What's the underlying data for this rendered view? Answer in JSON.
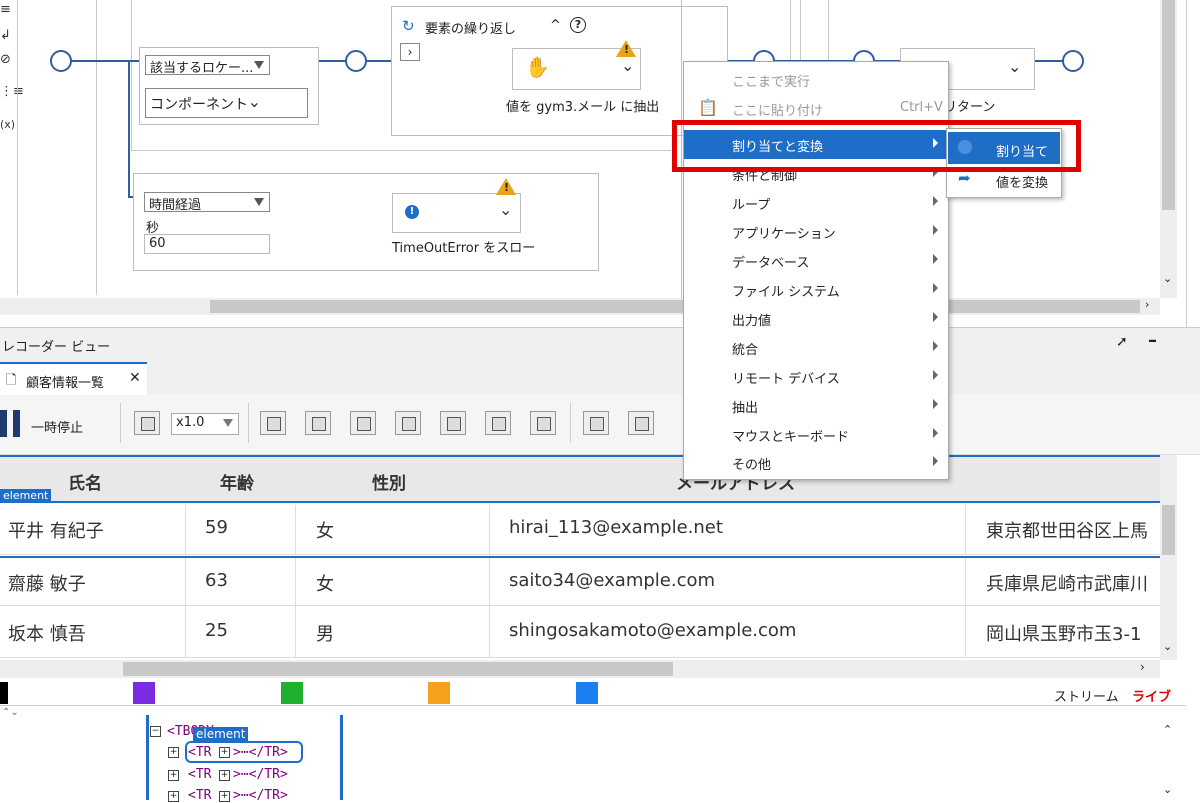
{
  "flow": {
    "locator_select": "該当するロケー...",
    "component_select": "コンポーネント",
    "loop_title": "要素の繰り返し",
    "loop_help": "?",
    "loop_collapse": "^",
    "extract_label": "値を gym3.メール に抽出",
    "timeout_select": "時間経過",
    "seconds_label": "秒",
    "seconds_value": "60",
    "throw_label": "TimeOutError をスロー",
    "return_label": "リターン"
  },
  "context_menu": {
    "items": [
      {
        "label": "ここまで実行",
        "disabled": true
      },
      {
        "label": "ここに貼り付け",
        "shortcut": "Ctrl+V",
        "disabled": true
      },
      {
        "label": "割り当てと変換",
        "highlighted": true
      },
      {
        "label": "条件と制御"
      },
      {
        "label": "ループ"
      },
      {
        "label": "アプリケーション"
      },
      {
        "label": "データベース"
      },
      {
        "label": "ファイル システム"
      },
      {
        "label": "出力値"
      },
      {
        "label": "統合"
      },
      {
        "label": "リモート デバイス"
      },
      {
        "label": "抽出"
      },
      {
        "label": "マウスとキーボード"
      },
      {
        "label": "その他"
      }
    ],
    "submenu": [
      {
        "label": "割り当て",
        "icon": "assign-icon"
      },
      {
        "label": "値を変換",
        "icon": "convert-arrow-icon"
      }
    ]
  },
  "recorder": {
    "panel_title": "レコーダー ビュー",
    "tab_label": "顧客情報一覧",
    "pause_label": "一時停止",
    "speed": "x1.0",
    "element_badge": "element"
  },
  "table": {
    "columns": [
      "氏名",
      "年齢",
      "性別",
      "メールアドレス"
    ],
    "rows": [
      {
        "name": "平井 有紀子",
        "age": "59",
        "gender": "女",
        "email": "hirai_113@example.net",
        "address": "東京都世田谷区上馬"
      },
      {
        "name": "齋藤 敏子",
        "age": "63",
        "gender": "女",
        "email": "saito34@example.com",
        "address": "兵庫県尼崎市武庫川"
      },
      {
        "name": "坂本 慎吾",
        "age": "25",
        "gender": "男",
        "email": "shingosakamoto@example.com",
        "address": "岡山県玉野市玉3-1"
      }
    ]
  },
  "status_bar": {
    "stream_label": "ストリーム",
    "live_label": "ライブ",
    "live_color": "#e00000",
    "swatches": [
      "#000000",
      "#7b2be0",
      "#1fb030",
      "#f5a11c",
      "#1a7ff0"
    ]
  },
  "dom_tree": {
    "root": "<TBODY>",
    "badge": "element",
    "rows": [
      "<TR",
      ">⋯</TR>",
      "<TR",
      ">⋯</TR>",
      "<TR",
      ">⋯</TR>"
    ]
  }
}
